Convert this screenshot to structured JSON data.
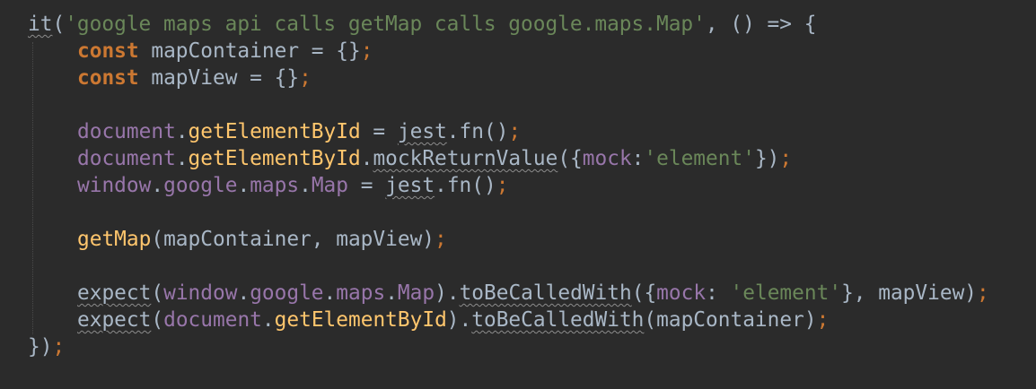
{
  "code": {
    "lines": [
      {
        "indent": false,
        "tokens": [
          {
            "text": "it",
            "type": "pl",
            "wavy": true
          },
          {
            "text": "(",
            "type": "pl"
          },
          {
            "text": "'google maps api calls getMap calls google.maps.Map'",
            "type": "str"
          },
          {
            "text": ", () => {",
            "type": "pl"
          }
        ]
      },
      {
        "indent": true,
        "tokens": [
          {
            "text": "const",
            "type": "kw"
          },
          {
            "text": " mapContainer = {}",
            "type": "pl"
          },
          {
            "text": ";",
            "type": "semi"
          }
        ]
      },
      {
        "indent": true,
        "tokens": [
          {
            "text": "const",
            "type": "kw"
          },
          {
            "text": " mapView = {}",
            "type": "pl"
          },
          {
            "text": ";",
            "type": "semi"
          }
        ]
      },
      {
        "indent": false,
        "tokens": []
      },
      {
        "indent": true,
        "tokens": [
          {
            "text": "document",
            "type": "obj"
          },
          {
            "text": ".",
            "type": "pl"
          },
          {
            "text": "getElementById",
            "type": "fnc"
          },
          {
            "text": " = ",
            "type": "pl"
          },
          {
            "text": "jest",
            "type": "pl",
            "wavy": true
          },
          {
            "text": ".fn()",
            "type": "pl"
          },
          {
            "text": ";",
            "type": "semi"
          }
        ]
      },
      {
        "indent": true,
        "tokens": [
          {
            "text": "document",
            "type": "obj"
          },
          {
            "text": ".",
            "type": "pl"
          },
          {
            "text": "getElementById",
            "type": "fnc"
          },
          {
            "text": ".",
            "type": "pl"
          },
          {
            "text": "mockReturnValue",
            "type": "pl",
            "wavy": true
          },
          {
            "text": "({",
            "type": "pl"
          },
          {
            "text": "mock",
            "type": "obj"
          },
          {
            "text": ":",
            "type": "pl"
          },
          {
            "text": "'element'",
            "type": "str"
          },
          {
            "text": "})",
            "type": "pl"
          },
          {
            "text": ";",
            "type": "semi"
          }
        ]
      },
      {
        "indent": true,
        "tokens": [
          {
            "text": "window",
            "type": "obj"
          },
          {
            "text": ".",
            "type": "pl"
          },
          {
            "text": "google",
            "type": "obj"
          },
          {
            "text": ".",
            "type": "pl"
          },
          {
            "text": "maps",
            "type": "obj"
          },
          {
            "text": ".",
            "type": "pl"
          },
          {
            "text": "Map",
            "type": "obj"
          },
          {
            "text": " = ",
            "type": "pl"
          },
          {
            "text": "jest",
            "type": "pl",
            "wavy": true
          },
          {
            "text": ".fn()",
            "type": "pl"
          },
          {
            "text": ";",
            "type": "semi"
          }
        ]
      },
      {
        "indent": false,
        "tokens": []
      },
      {
        "indent": true,
        "tokens": [
          {
            "text": "getMap",
            "type": "fnc"
          },
          {
            "text": "(mapContainer, mapView)",
            "type": "pl"
          },
          {
            "text": ";",
            "type": "semi"
          }
        ]
      },
      {
        "indent": false,
        "tokens": []
      },
      {
        "indent": true,
        "tokens": [
          {
            "text": "expect",
            "type": "pl",
            "wavy": true
          },
          {
            "text": "(",
            "type": "pl"
          },
          {
            "text": "window",
            "type": "obj"
          },
          {
            "text": ".",
            "type": "pl"
          },
          {
            "text": "google",
            "type": "obj"
          },
          {
            "text": ".",
            "type": "pl"
          },
          {
            "text": "maps",
            "type": "obj"
          },
          {
            "text": ".",
            "type": "pl"
          },
          {
            "text": "Map",
            "type": "obj"
          },
          {
            "text": ").",
            "type": "pl"
          },
          {
            "text": "toBeCalledWith",
            "type": "pl",
            "wavy": true
          },
          {
            "text": "({",
            "type": "pl"
          },
          {
            "text": "mock",
            "type": "obj"
          },
          {
            "text": ": ",
            "type": "pl"
          },
          {
            "text": "'element'",
            "type": "str"
          },
          {
            "text": "}, mapView)",
            "type": "pl"
          },
          {
            "text": ";",
            "type": "semi"
          }
        ]
      },
      {
        "indent": true,
        "tokens": [
          {
            "text": "expect",
            "type": "pl",
            "wavy": true
          },
          {
            "text": "(",
            "type": "pl"
          },
          {
            "text": "document",
            "type": "obj"
          },
          {
            "text": ".",
            "type": "pl"
          },
          {
            "text": "getElementById",
            "type": "fnc"
          },
          {
            "text": ").",
            "type": "pl"
          },
          {
            "text": "toBeCalledWith",
            "type": "pl",
            "wavy": true
          },
          {
            "text": "(mapContainer)",
            "type": "pl"
          },
          {
            "text": ";",
            "type": "semi"
          }
        ]
      },
      {
        "indent": false,
        "tokens": [
          {
            "text": "})",
            "type": "pl"
          },
          {
            "text": ";",
            "type": "semi"
          }
        ]
      }
    ]
  },
  "colors": {
    "background": "#2b2b2b",
    "default_text": "#a9b7c6",
    "keyword": "#cc7832",
    "string": "#6a8759",
    "property": "#9876aa",
    "function": "#ffc66d"
  }
}
